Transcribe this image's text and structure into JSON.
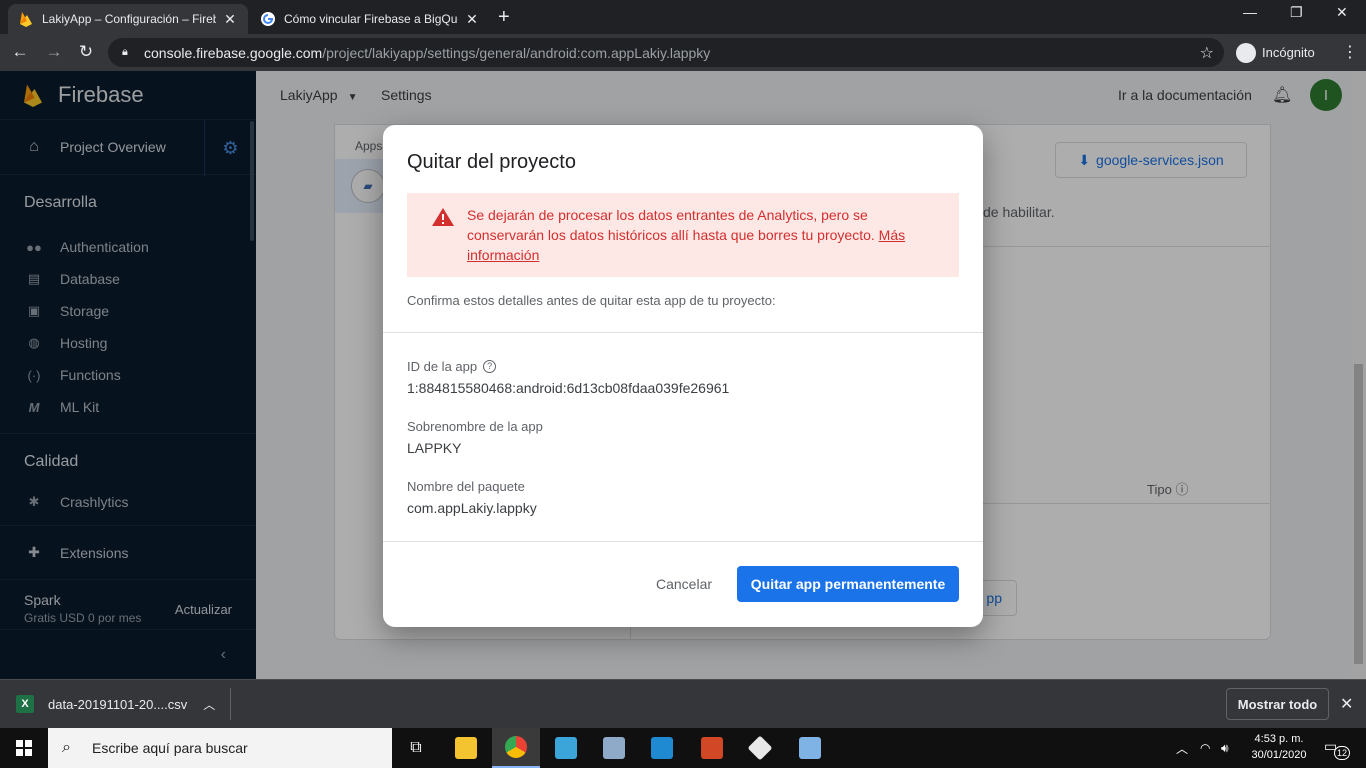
{
  "browser": {
    "tabs": [
      {
        "title": "LakiyApp – Configuración – Fireb",
        "active": true,
        "favicon": "firebase-icon"
      },
      {
        "title": "Cómo vincular Firebase a BigQue",
        "active": false,
        "favicon": "google-icon"
      }
    ],
    "url_host": "console.firebase.google.com",
    "url_path": "/project/lakiyapp/settings/general/android:com.appLakiy.lappky",
    "incognito_label": "Incógnito"
  },
  "sidebar": {
    "brand": "Firebase",
    "overview": "Project Overview",
    "sections": [
      {
        "title": "Desarrolla",
        "items": [
          {
            "label": "Authentication",
            "icon": "people-icon"
          },
          {
            "label": "Database",
            "icon": "database-icon"
          },
          {
            "label": "Storage",
            "icon": "storage-icon"
          },
          {
            "label": "Hosting",
            "icon": "globe-icon"
          },
          {
            "label": "Functions",
            "icon": "functions-icon"
          },
          {
            "label": "ML Kit",
            "icon": "mlkit-icon"
          }
        ]
      },
      {
        "title": "Calidad",
        "items": [
          {
            "label": "Crashlytics",
            "icon": "crashlytics-icon"
          }
        ]
      }
    ],
    "extensions": "Extensions",
    "plan_name": "Spark",
    "plan_price": "Gratis USD 0 por mes",
    "upgrade": "Actualizar"
  },
  "header": {
    "project": "LakiyApp",
    "crumb": "Settings",
    "docs": "Ir a la documentación",
    "avatar_letter": "I"
  },
  "background_card": {
    "apps_label": "Apps",
    "download_button": "google-services.json",
    "habilitar_text": "de habilitar.",
    "tipo_label": "Tipo",
    "add_button": "pp"
  },
  "modal": {
    "title": "Quitar del proyecto",
    "alert_text": "Se dejarán de procesar los datos entrantes de Analytics, pero se conservarán los datos históricos allí hasta que borres tu proyecto.",
    "alert_link": "Más información",
    "confirm_text": "Confirma estos detalles antes de quitar esta app de tu proyecto:",
    "app_id_label": "ID de la app",
    "app_id_value": "1:884815580468:android:6d13cb08fdaa039fe26961",
    "nickname_label": "Sobrenombre de la app",
    "nickname_value": "LAPPKY",
    "package_label": "Nombre del paquete",
    "package_value": "com.appLakiy.lappky",
    "cancel_label": "Cancelar",
    "remove_label": "Quitar app permanentemente"
  },
  "download_shelf": {
    "filename": "data-20191101-20....csv",
    "show_all": "Mostrar todo"
  },
  "taskbar": {
    "search_placeholder": "Escribe aquí para buscar",
    "time": "4:53 p. m.",
    "date": "30/01/2020",
    "notifications": "12"
  },
  "colors": {
    "accent": "#1a73e8",
    "alert_bg": "#fde8e6",
    "alert_text": "#d32f2f",
    "sidebar_bg": "#0b1b2e"
  }
}
